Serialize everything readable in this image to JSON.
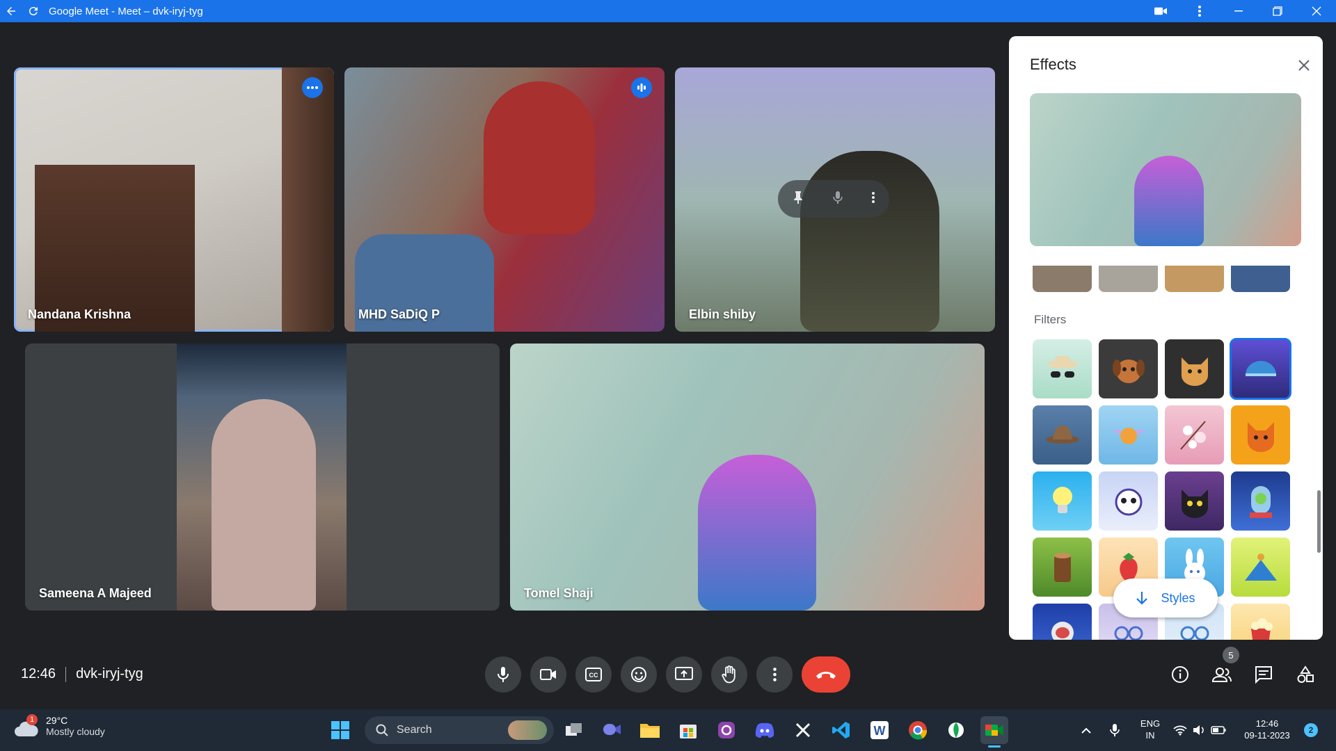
{
  "window": {
    "title": "Google Meet - Meet – dvk-iryj-tyg"
  },
  "participants": [
    {
      "name": "Nandana Krishna"
    },
    {
      "name": "MHD SaDiQ P"
    },
    {
      "name": "Elbin shiby"
    },
    {
      "name": "Sameena A Majeed"
    },
    {
      "name": "Tomel Shaji"
    }
  ],
  "effects": {
    "title": "Effects",
    "filters_label": "Filters",
    "styles_label": "Styles",
    "filters": [
      "sunglasses-hat",
      "puppy",
      "cat",
      "headphones-helmet",
      "cowboy-hat",
      "flying-cat",
      "cherry-blossom",
      "orange-cat",
      "lightbulb",
      "panda-astronaut",
      "black-cat",
      "alien-jar",
      "tree-stump",
      "strawberry",
      "bunny",
      "tent",
      "astronaut",
      "glasses",
      "eyeglasses",
      "popcorn"
    ]
  },
  "meeting": {
    "time": "12:46",
    "code": "dvk-iryj-tyg",
    "people_count": "5"
  },
  "taskbar": {
    "weather_badge": "1",
    "temperature": "29°C",
    "condition": "Mostly cloudy",
    "search_label": "Search",
    "lang_top": "ENG",
    "lang_bottom": "IN",
    "clock_time": "12:46",
    "clock_date": "09-11-2023",
    "notif_count": "2"
  },
  "colors": {
    "accent": "#1a73e8",
    "end_call": "#ea4335",
    "meet_bg": "#202124"
  }
}
